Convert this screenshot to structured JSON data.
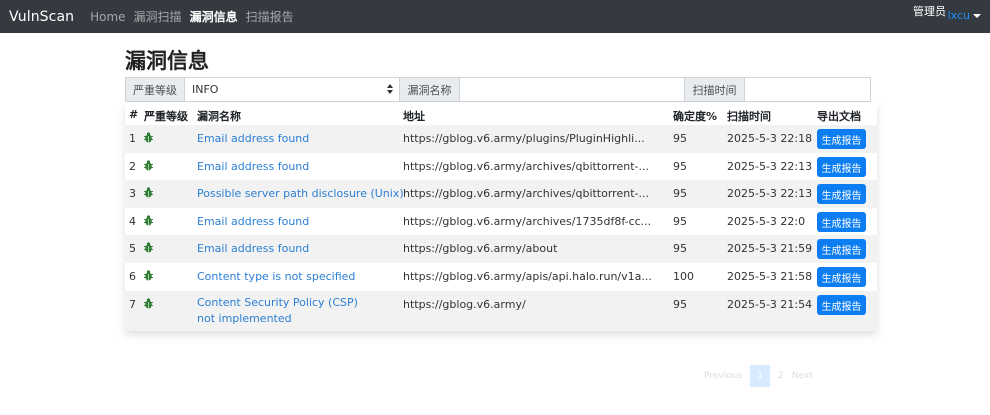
{
  "navbar": {
    "brand": "VulnScan",
    "links": [
      "Home",
      "漏洞扫描",
      "漏洞信息",
      "扫描报告"
    ],
    "admin_label": "管理员",
    "user": "lxcu"
  },
  "page": {
    "title": "漏洞信息"
  },
  "filter": {
    "severity_label": "严重等级",
    "severity_value": "INFO",
    "name_label": "漏洞名称",
    "name_value": "",
    "time_label": "扫描时间",
    "time_value": ""
  },
  "table": {
    "headers": [
      "#",
      "严重等级",
      "漏洞名称",
      "地址",
      "确定度%",
      "扫描时间",
      "导出文档"
    ],
    "severity_icon": "bug-icon",
    "severity_color": "#2e7d32",
    "button_label": "生成报告",
    "rows": [
      {
        "no": "1",
        "name": "Email address found",
        "url": "https://gblog.v6.army/plugins/PluginHighli...",
        "confidence": "95",
        "time": "2025-5-3 22:18"
      },
      {
        "no": "2",
        "name": "Email address found",
        "url": "https://gblog.v6.army/archives/qbittorrent-...",
        "confidence": "95",
        "time": "2025-5-3 22:13"
      },
      {
        "no": "3",
        "name": "Possible server path disclosure (Unix)",
        "url": "https://gblog.v6.army/archives/qbittorrent-...",
        "confidence": "95",
        "time": "2025-5-3 22:13"
      },
      {
        "no": "4",
        "name": "Email address found",
        "url": "https://gblog.v6.army/archives/1735df8f-cc...",
        "confidence": "95",
        "time": "2025-5-3 22:0"
      },
      {
        "no": "5",
        "name": "Email address found",
        "url": "https://gblog.v6.army/about",
        "confidence": "95",
        "time": "2025-5-3 21:59"
      },
      {
        "no": "6",
        "name": "Content type is not specified",
        "url": "https://gblog.v6.army/apis/api.halo.run/v1a...",
        "confidence": "100",
        "time": "2025-5-3 21:58"
      },
      {
        "no": "7",
        "name": "Content Security Policy (CSP) not implemented",
        "url": "https://gblog.v6.army/",
        "confidence": "95",
        "time": "2025-5-3 21:54"
      }
    ]
  },
  "pagination": {
    "prev": "Previous",
    "pages": [
      "1",
      "2"
    ],
    "next": "Next",
    "current": "1"
  },
  "colors": {
    "navbar": "#343a40",
    "link": "#2b7fd4",
    "button": "#0d7ef2"
  }
}
